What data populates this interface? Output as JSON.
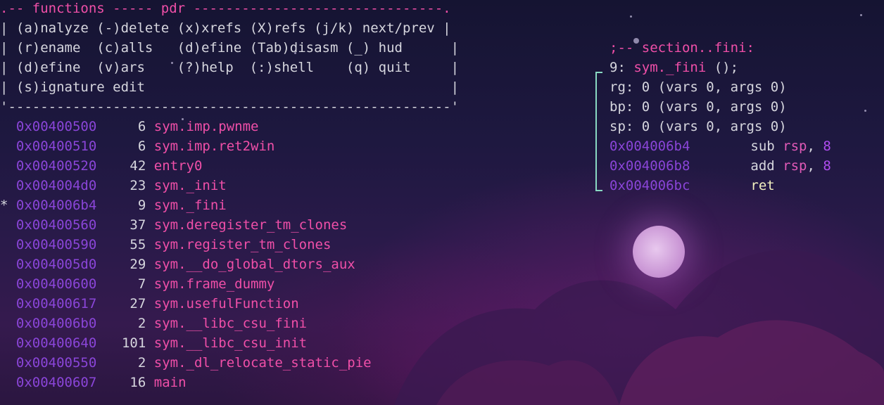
{
  "header": {
    "prefix": ".-- ",
    "panel_title": "functions",
    "sep": " ----- ",
    "mode": "pdr",
    "rest": " -------------------------------."
  },
  "help_rows": [
    "| (a)nalyze (-)delete (x)xrefs (X)refs (j/k) next/prev |",
    "| (r)ename  (c)alls   (d)efine (Tab)disasm (_) hud      |",
    "| (d)efine  (v)ars    (?)help  (:)shell    (q) quit     |",
    "| (s)ignature edit                                      |",
    "'-------------------------------------------------------'"
  ],
  "functions": [
    {
      "marker": " ",
      "addr": "0x00400500",
      "size": "6",
      "name": "sym.imp.pwnme"
    },
    {
      "marker": " ",
      "addr": "0x00400510",
      "size": "6",
      "name": "sym.imp.ret2win"
    },
    {
      "marker": " ",
      "addr": "0x00400520",
      "size": "42",
      "name": "entry0"
    },
    {
      "marker": " ",
      "addr": "0x004004d0",
      "size": "23",
      "name": "sym._init"
    },
    {
      "marker": "*",
      "addr": "0x004006b4",
      "size": "9",
      "name": "sym._fini"
    },
    {
      "marker": " ",
      "addr": "0x00400560",
      "size": "37",
      "name": "sym.deregister_tm_clones"
    },
    {
      "marker": " ",
      "addr": "0x00400590",
      "size": "55",
      "name": "sym.register_tm_clones"
    },
    {
      "marker": " ",
      "addr": "0x004005d0",
      "size": "29",
      "name": "sym.__do_global_dtors_aux"
    },
    {
      "marker": " ",
      "addr": "0x00400600",
      "size": "7",
      "name": "sym.frame_dummy"
    },
    {
      "marker": " ",
      "addr": "0x00400617",
      "size": "27",
      "name": "sym.usefulFunction"
    },
    {
      "marker": " ",
      "addr": "0x004006b0",
      "size": "2",
      "name": "sym.__libc_csu_fini"
    },
    {
      "marker": " ",
      "addr": "0x00400640",
      "size": "101",
      "name": "sym.__libc_csu_init"
    },
    {
      "marker": " ",
      "addr": "0x00400550",
      "size": "2",
      "name": "sym._dl_relocate_static_pie"
    },
    {
      "marker": " ",
      "addr": "0x00400607",
      "size": "16",
      "name": "main"
    }
  ],
  "disasm": {
    "section_comment": ";-- section..fini:",
    "sig_prefix": "9: ",
    "sig_name": "sym._fini",
    "sig_suffix": " ();",
    "info": [
      "rg: 0 (vars 0, args 0)",
      "bp: 0 (vars 0, args 0)",
      "sp: 0 (vars 0, args 0)"
    ],
    "instructions": [
      {
        "addr": "0x004006b4",
        "op": "sub",
        "reg": "rsp",
        "comma": ",",
        "imm": "8"
      },
      {
        "addr": "0x004006b8",
        "op": "add",
        "reg": "rsp",
        "comma": ",",
        "imm": "8"
      },
      {
        "addr": "0x004006bc",
        "op": "ret",
        "reg": "",
        "comma": "",
        "imm": ""
      }
    ]
  }
}
